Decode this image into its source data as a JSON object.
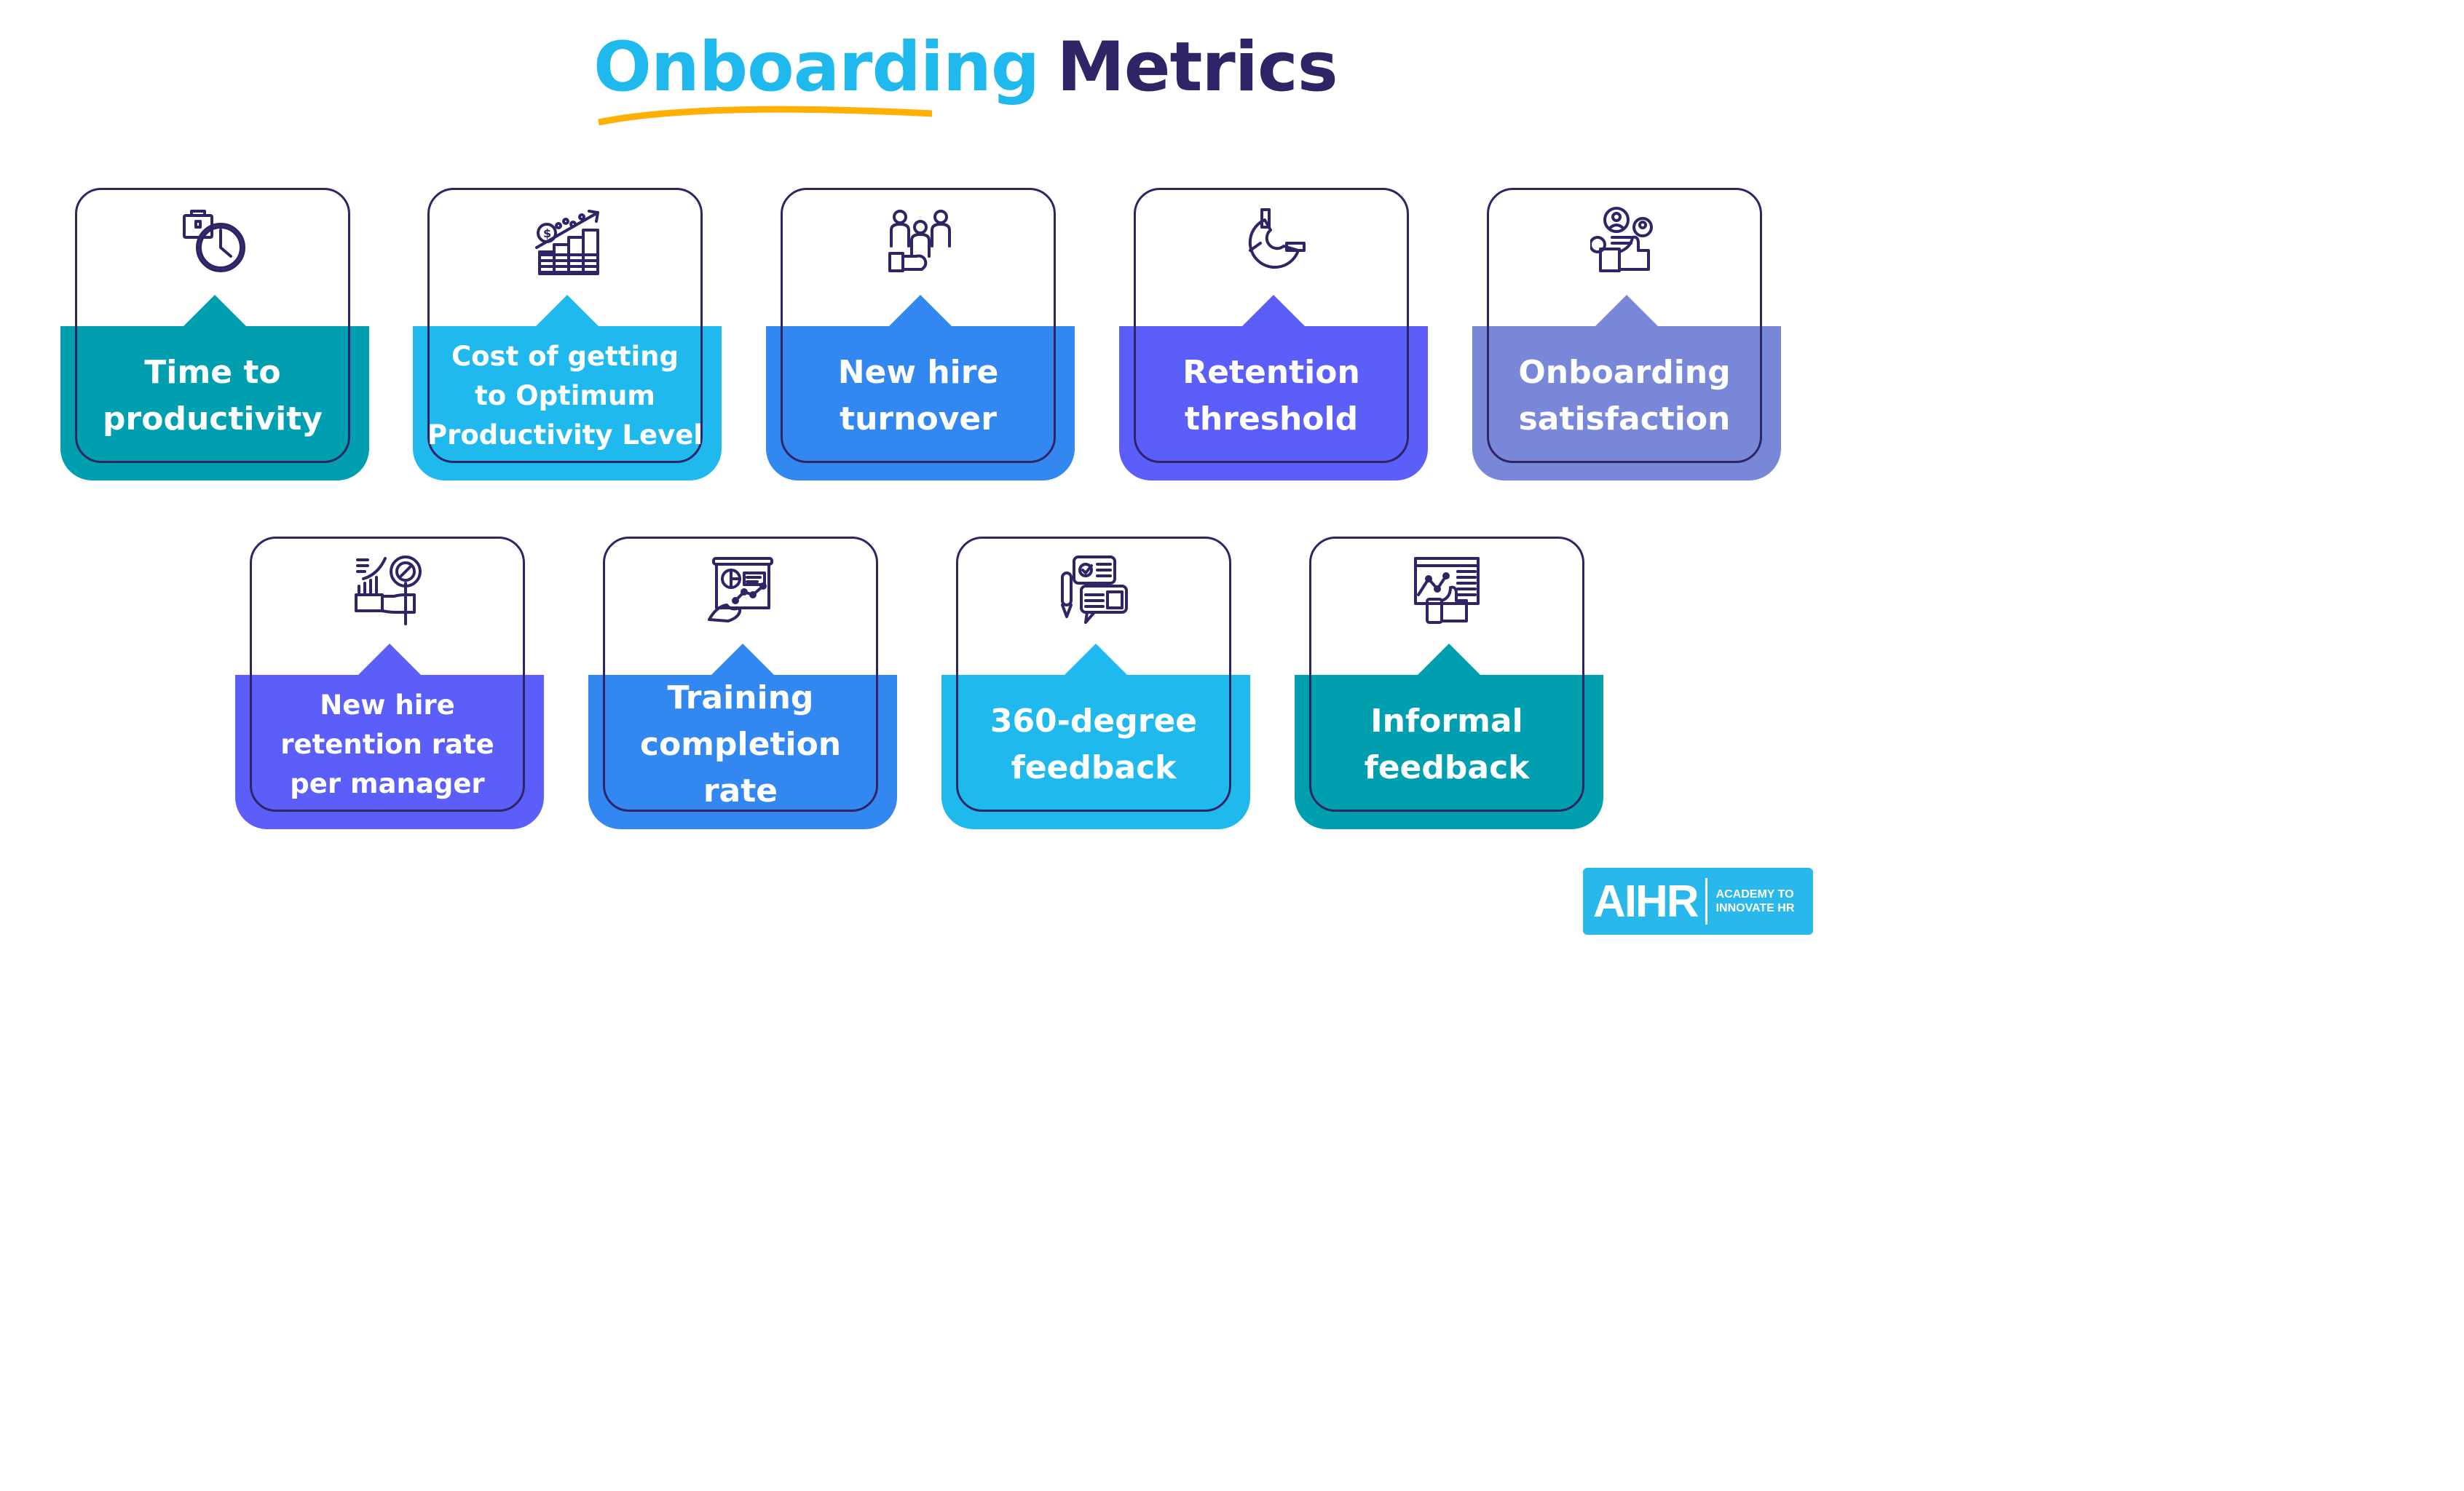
{
  "title": {
    "part1": "Onboarding",
    "part2": "Metrics"
  },
  "colors": {
    "title_accent": "#20b9ee",
    "title_dark": "#2e2466",
    "underline": "#ffb000",
    "outline": "#2e2466",
    "logo_bg": "#29b8ec"
  },
  "cards": [
    {
      "label": "Time to productivity",
      "lines": [
        "Time to",
        "productivity"
      ],
      "icon": "briefcase-clock-icon",
      "color": "#009fb0"
    },
    {
      "label": "Cost of getting to Optimum Productivity Level",
      "lines": [
        "Cost of getting",
        "to Optimum",
        "Productivity Level"
      ],
      "icon": "money-growth-icon",
      "color": "#20b9ee"
    },
    {
      "label": "New hire turnover",
      "lines": [
        "New hire",
        "turnover"
      ],
      "icon": "people-handshake-icon",
      "color": "#3287f0"
    },
    {
      "label": "Retention threshold",
      "lines": [
        "Retention",
        "threshold"
      ],
      "icon": "magnet-icon",
      "color": "#5b5ef9"
    },
    {
      "label": "Onboarding satisfaction",
      "lines": [
        "Onboarding",
        "satisfaction"
      ],
      "icon": "users-thumbs-up-icon",
      "color": "#7887d8"
    },
    {
      "label": "New hire retention rate per manager",
      "lines": [
        "New hire",
        "retention rate",
        "per manager"
      ],
      "icon": "hand-gauge-icon",
      "color": "#5b5ef9"
    },
    {
      "label": "Training completion rate",
      "lines": [
        "Training",
        "completion rate"
      ],
      "icon": "presentation-chart-icon",
      "color": "#3287f0"
    },
    {
      "label": "360-degree feedback",
      "lines": [
        "360-degree",
        "feedback"
      ],
      "icon": "feedback-chat-icon",
      "color": "#20b9ee"
    },
    {
      "label": "Informal feedback",
      "lines": [
        "Informal",
        "feedback"
      ],
      "icon": "dashboard-thumbs-up-icon",
      "color": "#009fb0"
    }
  ],
  "logo": {
    "mark": "AIHR",
    "tagline_1": "ACADEMY TO",
    "tagline_2": "INNOVATE HR"
  }
}
